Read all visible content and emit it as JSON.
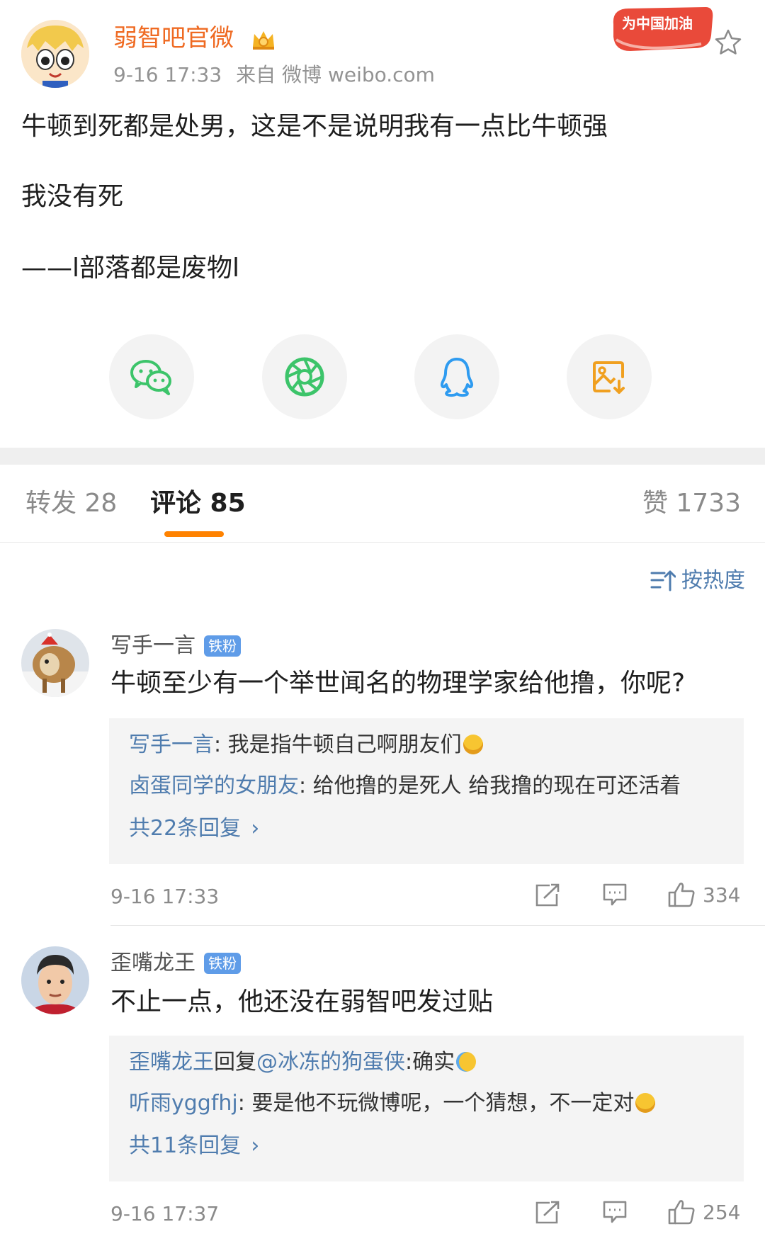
{
  "post": {
    "author": "弱智吧官微",
    "time": "9-16 17:33",
    "source": "来自 微博 weibo.com",
    "campaign_badge": "为中国加油",
    "lines": [
      "牛顿到死都是处男，这是不是说明我有一点比牛顿强",
      "我没有死",
      "——l部落都是废物l"
    ]
  },
  "share": {
    "icons": [
      "wechat-icon",
      "moments-icon",
      "qq-icon",
      "save-image-icon"
    ]
  },
  "tabs": {
    "repost": "转发 28",
    "comments": "评论 85",
    "likes": "赞 1733"
  },
  "sort": {
    "label": "按热度"
  },
  "comments": [
    {
      "user": "写手一言",
      "badge": "铁粉",
      "text": "牛顿至少有一个举世闻名的物理学家给他撸，你呢?",
      "replies": [
        {
          "name": "写手一言",
          "sep": ": ",
          "text": "我是指牛顿自己啊朋友们"
        },
        {
          "name": "卤蛋同学的女朋友",
          "sep": ": ",
          "text": "给他撸的是死人 给我撸的现在可还活着"
        }
      ],
      "more": "共22条回复",
      "time": "9-16 17:33",
      "likes": "334"
    },
    {
      "user": "歪嘴龙王",
      "badge": "铁粉",
      "text": "不止一点，他还没在弱智吧发过贴",
      "replies": [
        {
          "name": "歪嘴龙王",
          "mid": "回复",
          "at": "@冰冻的狗蛋侠",
          "sep": ":",
          "text": "确实"
        },
        {
          "name": "听雨yggfhj",
          "sep": ": ",
          "text": "要是他不玩微博呢，一个猜想，不一定对"
        }
      ],
      "more": "共11条回复",
      "time": "9-16 17:37",
      "likes": "254"
    }
  ],
  "colors": {
    "accent": "#ff8200",
    "author": "#ef6a22",
    "link": "#4f7cae",
    "badge": "#5f9ce8"
  }
}
